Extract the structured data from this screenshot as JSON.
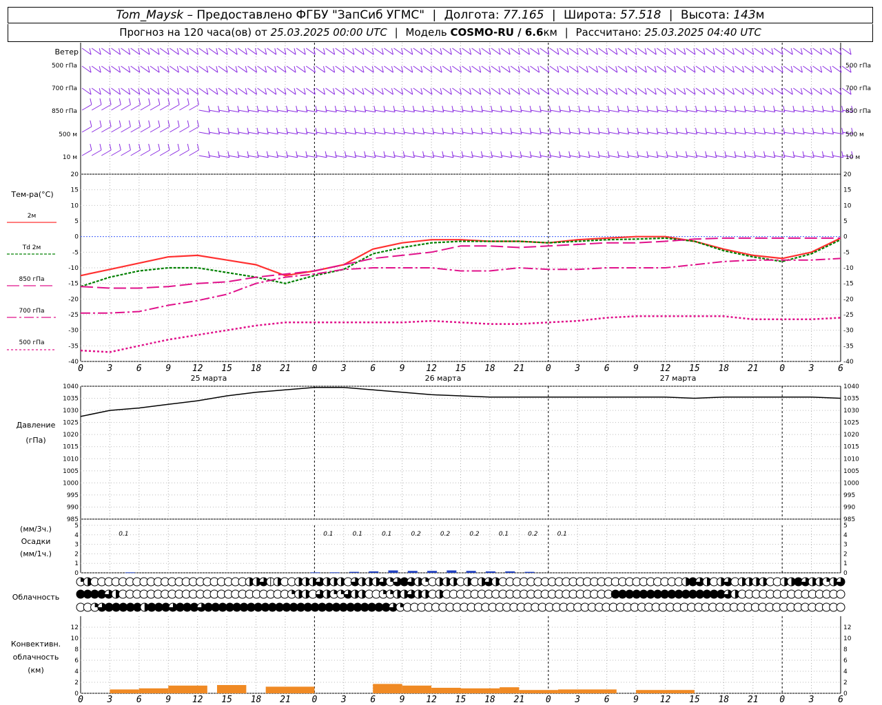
{
  "header": {
    "station": "Tom_Maysk",
    "provider": "– Предоставлено ФГБУ \"ЗапСиб УГМС\"",
    "lon_label": "Долгота:",
    "lon": "77.165",
    "lat_label": "Широта:",
    "lat": "57.518",
    "alt_label": "Высота:",
    "alt": "143",
    "alt_unit": "м",
    "forecast_label": "Прогноз на 120 часа(ов) от",
    "forecast_time": "25.03.2025 00:00 UTC",
    "model_label": "Модель",
    "model": "COSMO-RU / 6.6",
    "model_unit": "км",
    "calc_label": "Рассчитано:",
    "calc_time": "25.03.2025 04:40 UTC"
  },
  "wind_panel": {
    "title": "Ветер",
    "levels_left": [
      "500 гПа",
      "700 гПа",
      "850 гПа",
      "500 м",
      "10  м"
    ],
    "levels_right": [
      "500 гПа",
      "700 гПа",
      "850 гПа",
      "500 м",
      "10  м"
    ]
  },
  "temp_panel": {
    "ylabel": "Тем-ра(°С)",
    "legend": [
      "2м",
      "Td  2м",
      "850 гПа",
      "700 гПа",
      "500 гПа"
    ],
    "colors": [
      "#ff3030",
      "#008000",
      "#e0108a",
      "#e0108a",
      "#e0108a"
    ]
  },
  "pressure_panel": {
    "ylabel1": "Давление",
    "ylabel2": "(гПа)"
  },
  "precip_panel": {
    "ylabel1": "(мм/3ч.)",
    "ylabel2": "Осадки",
    "ylabel3": "(мм/1ч.)"
  },
  "cloud_panel": {
    "ylabel": "Облачность"
  },
  "conv_panel": {
    "ylabel1": "Конвективн.",
    "ylabel2": "облачность",
    "ylabel3": "(км)"
  },
  "x_axis": {
    "hours": [
      0,
      3,
      6,
      9,
      12,
      15,
      18,
      21,
      0,
      3,
      6,
      9,
      12,
      15,
      18,
      21,
      0,
      3,
      6,
      9,
      12,
      15,
      18,
      21,
      0,
      3,
      6
    ],
    "dates": [
      "25 марта",
      "26 марта",
      "27 марта"
    ]
  },
  "chart_data": [
    {
      "type": "line",
      "title": "Тем-ра(°С)",
      "ylim": [
        -40,
        20
      ],
      "yticks": [
        20,
        15,
        10,
        5,
        0,
        -5,
        -10,
        -15,
        -20,
        -25,
        -30,
        -35,
        -40
      ],
      "x": [
        0,
        3,
        6,
        9,
        12,
        15,
        18,
        21,
        24,
        27,
        30,
        33,
        36,
        39,
        42,
        45,
        48,
        51,
        54,
        57,
        60,
        63,
        66,
        69,
        72,
        75,
        78
      ],
      "series": [
        {
          "name": "2м",
          "values": [
            -12.5,
            -10.5,
            -8.5,
            -6.5,
            -6,
            -7.5,
            -9,
            -12.5,
            -11,
            -9,
            -4,
            -2,
            -1,
            -1,
            -1.5,
            -1.5,
            -2,
            -1,
            -0.5,
            0,
            0,
            -1.5,
            -4,
            -6,
            -7,
            -5,
            -0.5
          ]
        },
        {
          "name": "Td  2м",
          "values": [
            -16,
            -13,
            -11,
            -10,
            -10,
            -11.5,
            -13,
            -15,
            -12.5,
            -10.5,
            -5.5,
            -3.5,
            -2,
            -1.5,
            -1.5,
            -1.5,
            -2,
            -1.5,
            -1,
            -0.8,
            -0.5,
            -1.5,
            -4.5,
            -6.5,
            -8,
            -5.5,
            -1
          ]
        },
        {
          "name": "850 гПа",
          "values": [
            -16,
            -16.5,
            -16.5,
            -16,
            -15,
            -14.5,
            -13,
            -12,
            -11,
            -9,
            -7,
            -6,
            -5,
            -3,
            -3,
            -3.5,
            -3,
            -2.5,
            -2,
            -2,
            -1.5,
            -0.8,
            -0.5,
            -0.5,
            -0.5,
            -0.5,
            -0.5
          ]
        },
        {
          "name": "700 гПа",
          "values": [
            -24.5,
            -24.5,
            -24,
            -22,
            -20.5,
            -18.5,
            -15,
            -13,
            -12,
            -10.5,
            -10,
            -10,
            -10,
            -11,
            -11,
            -10,
            -10.5,
            -10.5,
            -10,
            -10,
            -10,
            -9,
            -8,
            -7.5,
            -7.5,
            -7.5,
            -7
          ]
        },
        {
          "name": "500 гПа",
          "values": [
            -36.5,
            -37,
            -35,
            -33,
            -31.5,
            -30,
            -28.5,
            -27.5,
            -27.5,
            -27.5,
            -27.5,
            -27.5,
            -27,
            -27.5,
            -28,
            -28,
            -27.5,
            -27,
            -26,
            -25.5,
            -25.5,
            -25.5,
            -25.5,
            -26.5,
            -26.5,
            -26.5,
            -26
          ]
        }
      ]
    },
    {
      "type": "line",
      "title": "Давление (гПа)",
      "ylim": [
        985,
        1040
      ],
      "yticks": [
        1040,
        1035,
        1030,
        1025,
        1020,
        1015,
        1010,
        1005,
        1000,
        995,
        990,
        985
      ],
      "x": [
        0,
        3,
        6,
        9,
        12,
        15,
        18,
        21,
        24,
        27,
        30,
        33,
        36,
        39,
        42,
        45,
        48,
        51,
        54,
        57,
        60,
        63,
        66,
        69,
        72,
        75,
        78
      ],
      "series": [
        {
          "name": "Давление",
          "values": [
            1027.5,
            1030,
            1031,
            1032.5,
            1034,
            1036,
            1037.5,
            1038.5,
            1039.5,
            1039.5,
            1038.5,
            1037.5,
            1036.5,
            1036,
            1035.5,
            1035.5,
            1035.5,
            1035.5,
            1035.5,
            1035.5,
            1035.5,
            1035,
            1035.5,
            1035.5,
            1035.5,
            1035.5,
            1035
          ]
        }
      ]
    },
    {
      "type": "bar",
      "title": "Осадки",
      "ylim": [
        0,
        5
      ],
      "yticks": [
        5,
        4,
        3,
        2,
        1,
        0
      ],
      "labels_x": [
        3,
        24,
        27,
        30,
        33,
        36,
        39,
        42,
        45,
        48
      ],
      "labels": [
        "0.1",
        "0.1",
        "0.1",
        "0.1",
        "0.2",
        "0.2",
        "0.2",
        "0.1",
        "0.2",
        "0.1"
      ],
      "x": [
        5,
        24,
        26,
        28,
        30,
        32,
        34,
        36,
        38,
        40,
        42,
        44,
        46
      ],
      "values": [
        0.05,
        0.05,
        0.05,
        0.1,
        0.15,
        0.25,
        0.2,
        0.2,
        0.25,
        0.2,
        0.15,
        0.15,
        0.1
      ]
    },
    {
      "type": "heatmap",
      "title": "Облачность",
      "rows": [
        "высокая",
        "средняя",
        "нижняя"
      ],
      "values": [
        "QH0000000000000000000000HH32H00HHH3HHH03HHH3Q3F3HQ0HHH0H0H3H00000000000000000000000000HF3H0H30HHHH00HHF3HHQH3",
        "FFFF3H000000000000000000000000QHH03HQQ3HH00QQHH3HH0H000000000000000000000000FFFFFFFFFFFFFFFF3H000000000000000",
        "00Q3FFFFFHFFF3FFF3FFFFFFFFFFFFFFFFFFFFFFFFFF3Q00000000000000000000000000000000000000000000000000000000000000"
      ]
    },
    {
      "type": "bar",
      "title": "Конвективн. облачность (км)",
      "ylim": [
        0,
        14
      ],
      "yticks": [
        12,
        10,
        8,
        6,
        4,
        2,
        0
      ],
      "segments": [
        [
          3,
          6,
          0.7
        ],
        [
          6,
          9,
          0.9
        ],
        [
          9,
          13,
          1.4
        ],
        [
          14,
          17,
          1.5
        ],
        [
          19,
          24,
          1.2
        ],
        [
          30,
          33,
          1.7
        ],
        [
          33,
          36,
          1.4
        ],
        [
          36,
          39,
          1
        ],
        [
          39,
          43,
          0.9
        ],
        [
          43,
          45,
          1.1
        ],
        [
          45,
          49,
          0.6
        ],
        [
          49,
          55,
          0.7
        ],
        [
          57,
          63,
          0.6
        ]
      ]
    }
  ]
}
